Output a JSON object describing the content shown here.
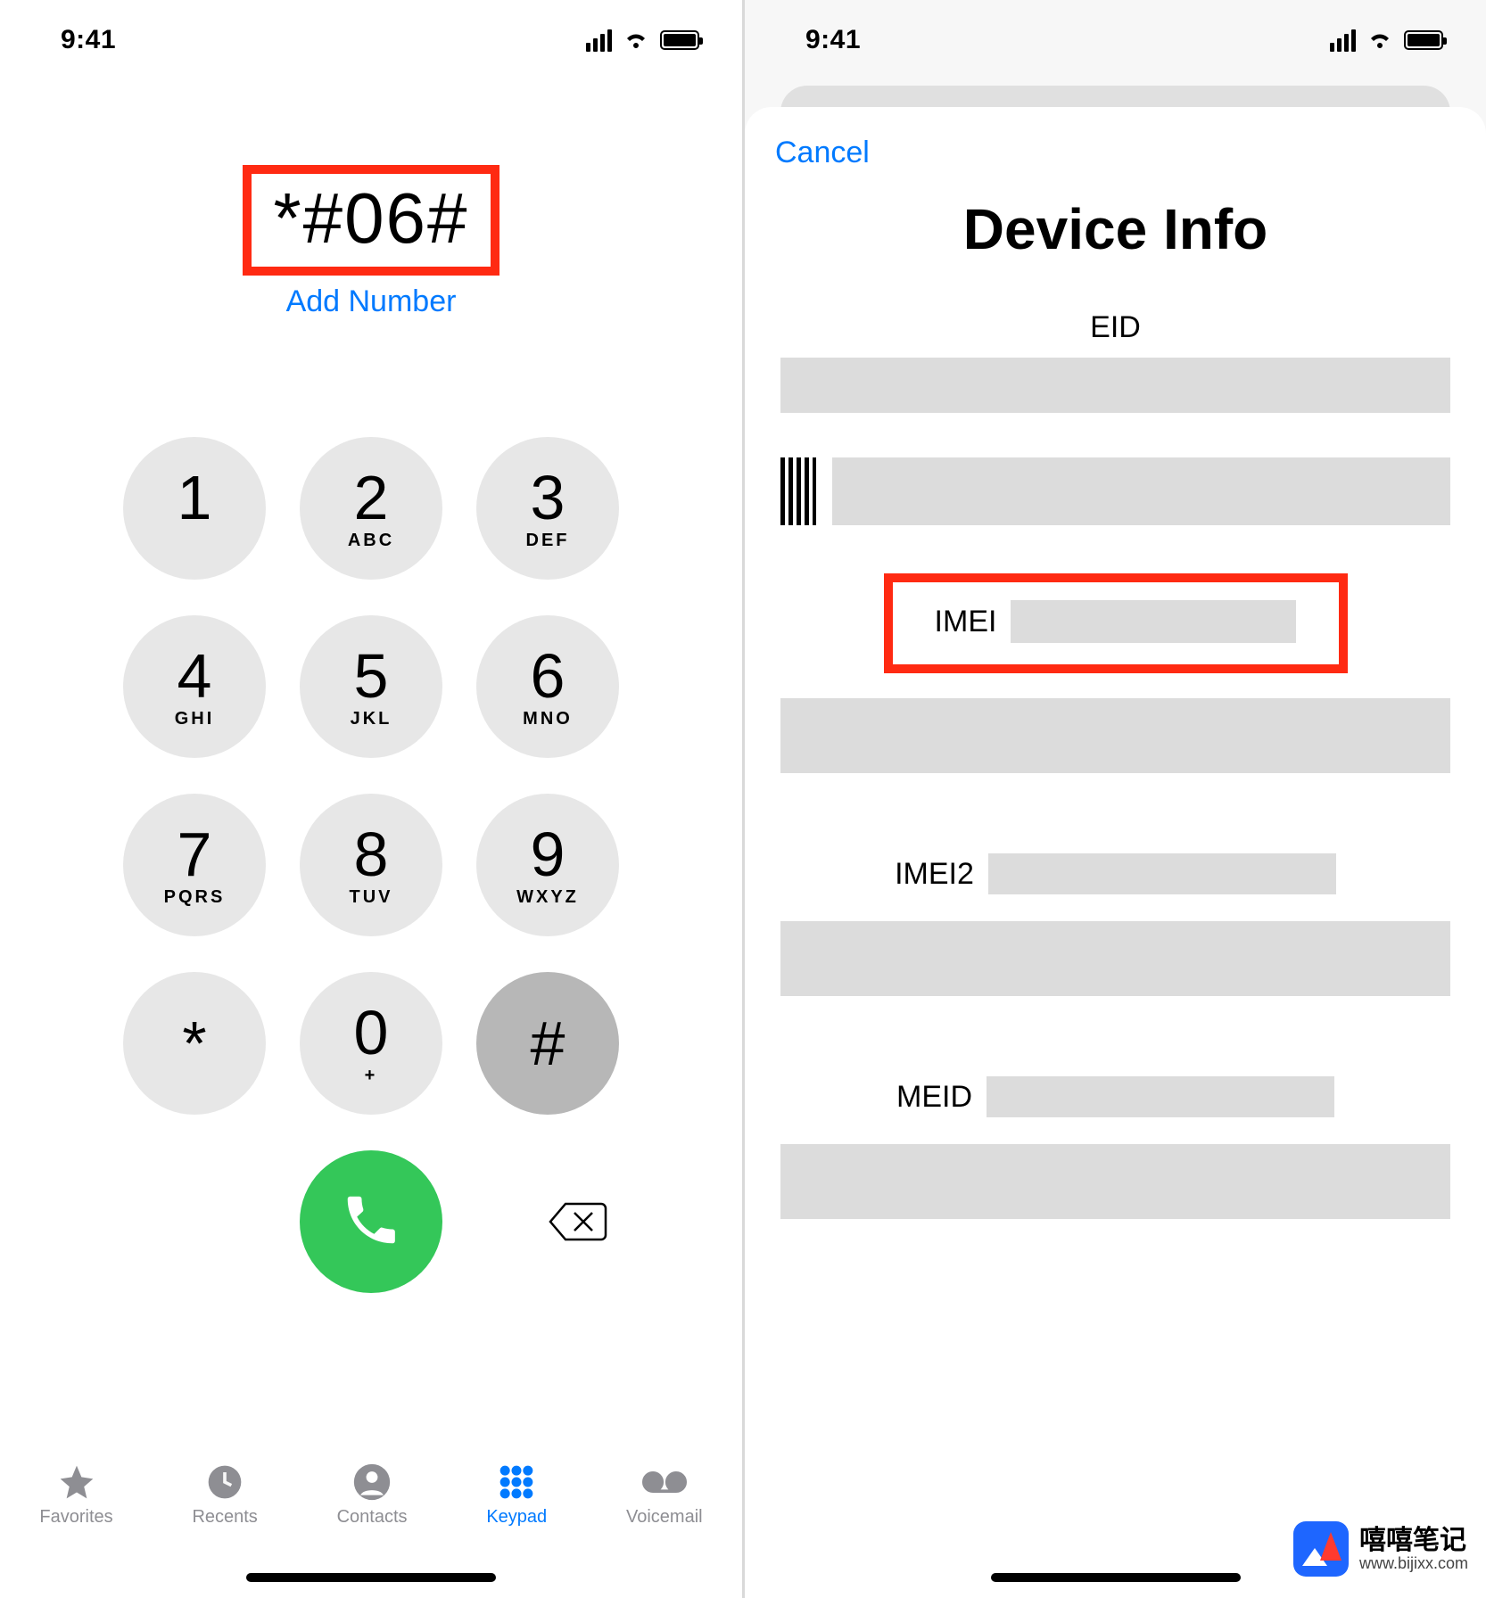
{
  "status": {
    "time": "9:41"
  },
  "left": {
    "dialed": "*#06#",
    "add_number": "Add Number",
    "keys": [
      {
        "digit": "1",
        "letters": ""
      },
      {
        "digit": "2",
        "letters": "ABC"
      },
      {
        "digit": "3",
        "letters": "DEF"
      },
      {
        "digit": "4",
        "letters": "GHI"
      },
      {
        "digit": "5",
        "letters": "JKL"
      },
      {
        "digit": "6",
        "letters": "MNO"
      },
      {
        "digit": "7",
        "letters": "PQRS"
      },
      {
        "digit": "8",
        "letters": "TUV"
      },
      {
        "digit": "9",
        "letters": "WXYZ"
      },
      {
        "digit": "*",
        "letters": ""
      },
      {
        "digit": "0",
        "letters": "+"
      },
      {
        "digit": "#",
        "letters": ""
      }
    ],
    "tabs": {
      "favorites": "Favorites",
      "recents": "Recents",
      "contacts": "Contacts",
      "keypad": "Keypad",
      "voicemail": "Voicemail"
    }
  },
  "right": {
    "cancel": "Cancel",
    "title": "Device Info",
    "eid_label": "EID",
    "imei_label": "IMEI",
    "imei2_label": "IMEI2",
    "meid_label": "MEID"
  },
  "watermark": {
    "brand": "嘻嘻笔记",
    "url": "www.bijixx.com"
  },
  "colors": {
    "ios_blue": "#007aff",
    "ios_green": "#34c759",
    "highlight_red": "#ff2a12",
    "key_gray": "#e7e7e7",
    "key_dark_gray": "#b7b7b7",
    "inactive": "#8e8e93",
    "redact": "#dcdcdc"
  }
}
